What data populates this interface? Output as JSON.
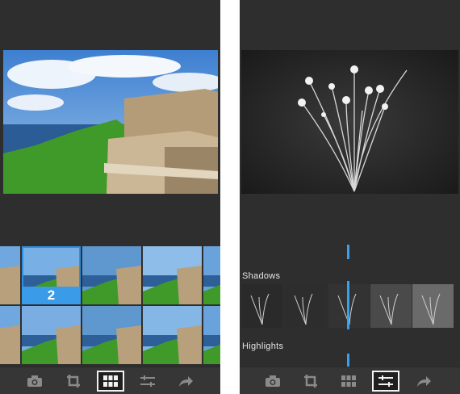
{
  "left_panel": {
    "photo_icon": "coastal-fort-photo",
    "selected_filter_number": "2",
    "toolbar": [
      "camera-icon",
      "crop-icon",
      "grid-icon",
      "sliders-icon",
      "share-arrow-icon"
    ],
    "active_tool": "grid-icon"
  },
  "right_panel": {
    "photo_icon": "flowers-bw-photo",
    "adjustments": [
      {
        "label": "Shadows"
      },
      {
        "label": "Highlights"
      }
    ],
    "toolbar": [
      "camera-icon",
      "crop-icon",
      "grid-icon",
      "sliders-icon",
      "share-arrow-icon"
    ],
    "active_tool": "sliders-icon"
  },
  "colors": {
    "accent": "#3a9be8",
    "panel_bg": "#2e2e2e",
    "toolbar_bg": "#363636"
  }
}
